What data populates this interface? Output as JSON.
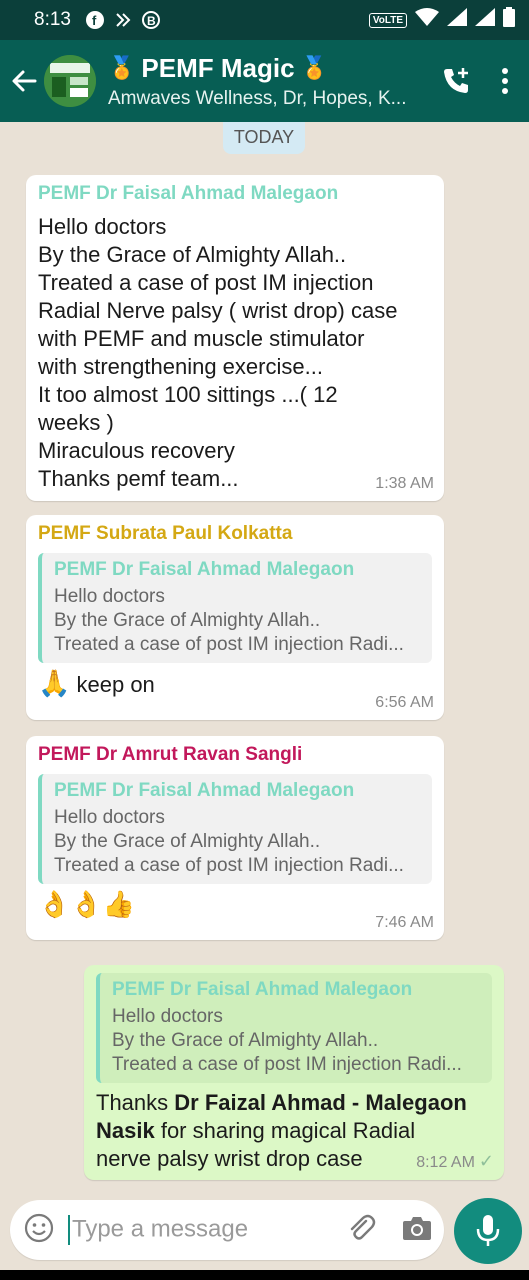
{
  "status_bar": {
    "time": "8:13",
    "network": "VoLTE"
  },
  "header": {
    "title": "PEMF Magic",
    "medal_left": "🏅",
    "medal_right": "🏅",
    "subtitle": "Amwaves Wellness, Dr, Hopes, K...",
    "accent": "#075e54"
  },
  "chat": {
    "date_chip": "TODAY",
    "messages": [
      {
        "sender": "PEMF Dr Faisal Ahmad Malegaon",
        "sender_color": "#7fd9c2",
        "lines": [
          "Hello doctors",
          "By the Grace of Almighty Allah..",
          "Treated a case of post IM injection",
          "Radial Nerve palsy ( wrist drop)  case",
          "with PEMF and muscle stimulator",
          "with strengthening exercise...",
          "It too almost 100 sittings ...( 12",
          "weeks )",
          "Miraculous recovery",
          "Thanks pemf team..."
        ],
        "time": "1:38 AM"
      },
      {
        "sender": "PEMF Subrata Paul Kolkatta",
        "sender_color": "#d4a814",
        "quote": {
          "name": "PEMF Dr Faisal Ahmad Malegaon",
          "lines": [
            "Hello doctors",
            "By the Grace of Almighty Allah..",
            "Treated a case of post IM injection Radi..."
          ]
        },
        "emoji": "🙏",
        "text": "keep on",
        "time": "6:56 AM"
      },
      {
        "sender": "PEMF Dr Amrut Ravan Sangli",
        "sender_color": "#c2185b",
        "quote": {
          "name": "PEMF Dr Faisal Ahmad Malegaon",
          "lines": [
            "Hello doctors",
            "By the Grace of Almighty Allah..",
            "Treated a case of post IM injection Radi..."
          ]
        },
        "emoji": "👌👌👍",
        "time": "7:46 AM"
      },
      {
        "outgoing": true,
        "quote": {
          "name": "PEMF Dr Faisal Ahmad Malegaon",
          "lines": [
            "Hello doctors",
            "By the Grace of Almighty Allah..",
            "Treated a case of post IM injection Radi..."
          ]
        },
        "text_pre": "Thanks ",
        "text_bold_1": "Dr Faizal Ahmad - Malegaon",
        "text_bold_2": "Nasik",
        "text_post_1": " for sharing magical Radial",
        "text_post_2": "nerve palsy wrist drop case",
        "time": "8:12 AM",
        "ticks": "✓"
      }
    ]
  },
  "composer": {
    "placeholder": "Type a message"
  }
}
